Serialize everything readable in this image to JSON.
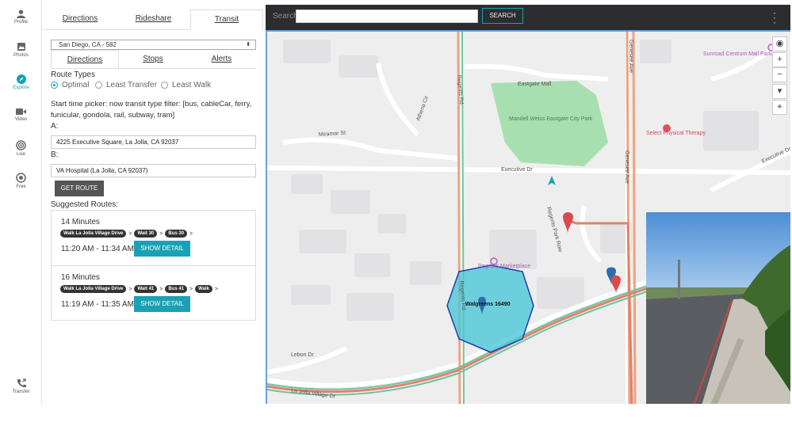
{
  "nav": {
    "items": [
      {
        "label": "Profile",
        "icon": "person-icon"
      },
      {
        "label": "Photos",
        "icon": "photos-icon"
      },
      {
        "label": "Explore",
        "icon": "compass-icon",
        "active": true
      },
      {
        "label": "Video",
        "icon": "video-icon"
      },
      {
        "label": "Live",
        "icon": "live-icon"
      },
      {
        "label": "Free",
        "icon": "free-icon"
      }
    ],
    "bottom": {
      "label": "Transfer",
      "icon": "phone-transfer-icon"
    }
  },
  "panel": {
    "tabs": [
      "Directions",
      "Rideshare",
      "Transit"
    ],
    "active_tab": "Transit",
    "route_select": "San Diego, CA - 582",
    "sub_tabs": [
      "Directions",
      "Stops",
      "Alerts"
    ],
    "active_sub_tab": "Directions",
    "route_types_label": "Route Types",
    "route_types": [
      "Optimal",
      "Least Transfer",
      "Least Walk"
    ],
    "selected_route_type": "Optimal",
    "note": "Start time picker: now transit type filter: [bus, cableCar, ferry, funicular, gondola, rail, subway, tram]",
    "a_label": "A:",
    "a_value": "4225 Executive Square, La Jolla, CA 92037",
    "b_label": "B:",
    "b_value": "VA Hospital (La Jolla, CA 92037)",
    "get_route_label": "GET ROUTE",
    "suggested_label": "Suggested Routes:",
    "routes": [
      {
        "duration": "14 Minutes",
        "steps": [
          "Walk La Jolla Village Drive",
          "Wait 30",
          "Bus 30"
        ],
        "time": "11:20 AM - 11:34 AM",
        "detail_label": "SHOW DETAIL"
      },
      {
        "duration": "16 Minutes",
        "steps": [
          "Walk La Jolla Village Drive",
          "Wait 41",
          "Bus 41",
          "Walk"
        ],
        "time": "11:19 AM - 11:35 AM",
        "detail_label": "SHOW DETAIL"
      }
    ]
  },
  "search": {
    "label": "Search",
    "value": "",
    "button": "SEARCH"
  },
  "map": {
    "labels": {
      "eastgate_mall": "Eastgate Mall",
      "park": "Mandell Weiss Eastgate City Park",
      "miramar_st": "Miramar St",
      "athena_cir": "Athena Cir",
      "regents_rd": "Regents Rd",
      "executive_dr": "Executive Dr",
      "executive_dr_east": "Executive Dr",
      "genesee_ave": "Genesee Ave",
      "regents_park_row": "Regents Park Row",
      "select_therapy": "Select Physical Therapy",
      "sunroad": "Sunroad Centrum Mall Parking",
      "marketplace": "Regents Marketplace",
      "walgreens": "Walgreens 16490",
      "lebon_dr": "Lebon Dr",
      "la_jolla_village_dr": "La Jolla Village Dr",
      "regents_rd_lower": "Regents Rd"
    },
    "controls": [
      "compass-icon",
      "zoom-in-icon",
      "zoom-out-icon",
      "pegman-icon",
      "location-icon"
    ]
  },
  "colors": {
    "accent": "#1aa1b5",
    "dark": "#2b2d31",
    "route": "#e0826a",
    "transit": "#6cc3a0",
    "park": "#a8dfb0",
    "hexagon": "#4cc7d6"
  }
}
